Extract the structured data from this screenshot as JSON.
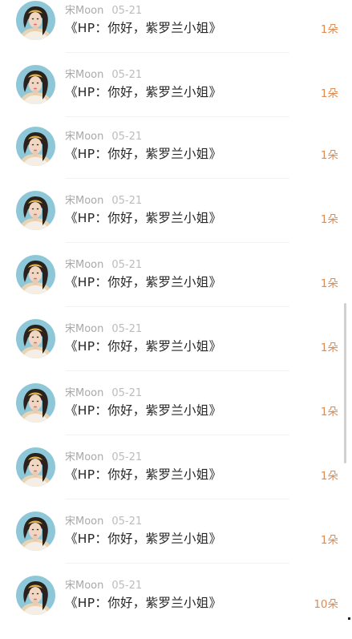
{
  "colors": {
    "name_text": "#a9a9a9",
    "date_text": "#bcbcbc",
    "title_text": "#262626",
    "count_text": "#e08a50",
    "avatar_bg": "#8ec7d8",
    "divider": "#f2f2f2"
  },
  "comments": [
    {
      "user": "宋Moon",
      "date": "05-21",
      "title": "《HP：你好，紫罗兰小姐》",
      "count": "1朵",
      "avatar_icon": "user-avatar-icon"
    },
    {
      "user": "宋Moon",
      "date": "05-21",
      "title": "《HP：你好，紫罗兰小姐》",
      "count": "1朵",
      "avatar_icon": "user-avatar-icon"
    },
    {
      "user": "宋Moon",
      "date": "05-21",
      "title": "《HP：你好，紫罗兰小姐》",
      "count": "1朵",
      "avatar_icon": "user-avatar-icon"
    },
    {
      "user": "宋Moon",
      "date": "05-21",
      "title": "《HP：你好，紫罗兰小姐》",
      "count": "1朵",
      "avatar_icon": "user-avatar-icon"
    },
    {
      "user": "宋Moon",
      "date": "05-21",
      "title": "《HP：你好，紫罗兰小姐》",
      "count": "1朵",
      "avatar_icon": "user-avatar-icon"
    },
    {
      "user": "宋Moon",
      "date": "05-21",
      "title": "《HP：你好，紫罗兰小姐》",
      "count": "1朵",
      "avatar_icon": "user-avatar-icon"
    },
    {
      "user": "宋Moon",
      "date": "05-21",
      "title": "《HP：你好，紫罗兰小姐》",
      "count": "1朵",
      "avatar_icon": "user-avatar-icon"
    },
    {
      "user": "宋Moon",
      "date": "05-21",
      "title": "《HP：你好，紫罗兰小姐》",
      "count": "1朵",
      "avatar_icon": "user-avatar-icon"
    },
    {
      "user": "宋Moon",
      "date": "05-21",
      "title": "《HP：你好，紫罗兰小姐》",
      "count": "1朵",
      "avatar_icon": "user-avatar-icon"
    },
    {
      "user": "宋Moon",
      "date": "05-21",
      "title": "《HP：你好，紫罗兰小姐》",
      "count": "10朵",
      "avatar_icon": "user-avatar-icon"
    }
  ]
}
